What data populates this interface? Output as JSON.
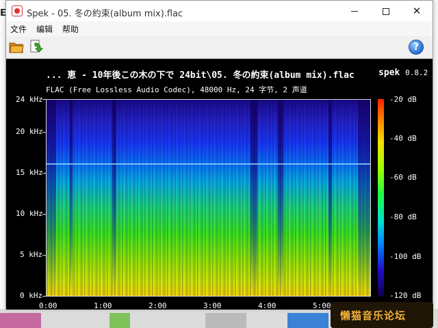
{
  "desktop": {
    "left_mark": "E"
  },
  "window": {
    "title": "Spek - 05. 冬の約束(album mix).flac",
    "controls": {
      "minimize": "minimize",
      "maximize": "maximize",
      "close": "✕"
    }
  },
  "menu": {
    "file": "文件",
    "edit": "编辑",
    "help": "帮助"
  },
  "toolbar": {
    "open_icon": "folder-open-icon",
    "reload_icon": "reload-icon",
    "help_icon": "help-icon",
    "help_glyph": "?"
  },
  "spek": {
    "track_title": "... 恵 - 10年後この木の下で 24bit\\05. 冬の約束(album mix).flac",
    "app_name": "spek",
    "version": "0.8.2",
    "format_info": "FLAC (Free Lossless Audio Codec), 48000 Hz, 24 字节, 2 声道",
    "y_ticks": [
      "24 kHz",
      "20 kHz",
      "15 kHz",
      "10 kHz",
      "5 kHz",
      "0 kHz"
    ],
    "x_ticks": [
      "0:00",
      "1:00",
      "2:00",
      "3:00",
      "4:00",
      "5:00"
    ],
    "db_ticks": [
      "-20 dB",
      "-40 dB",
      "-60 dB",
      "-80 dB",
      "-100 dB",
      "-120 dB"
    ],
    "colors": {
      "background": "#000000",
      "text": "#ffffff"
    }
  },
  "watermark": {
    "text": "懒猫音乐论坛"
  }
}
